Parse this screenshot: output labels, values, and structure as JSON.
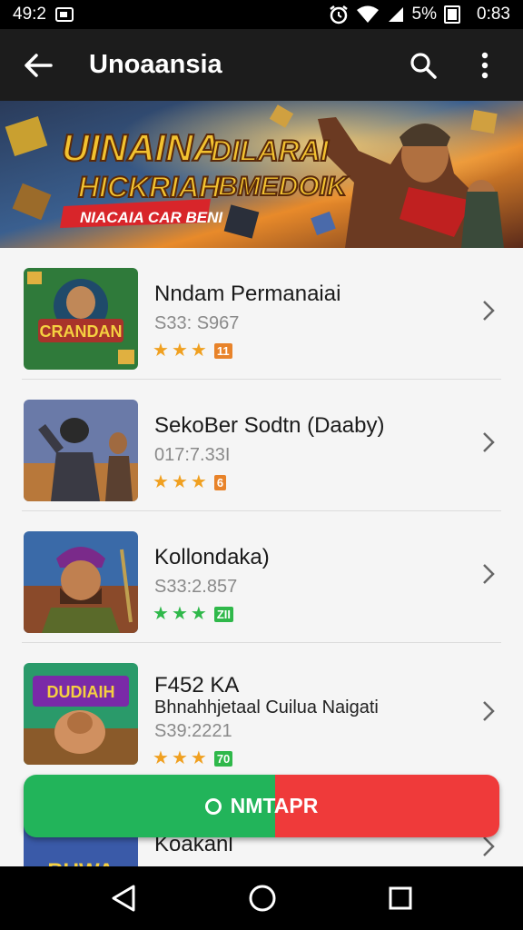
{
  "status_bar": {
    "time": "49:2",
    "battery_percent": "5%",
    "clock": "0:83"
  },
  "app_bar": {
    "title": "Unoaansia",
    "back_icon": "arrow-left-icon",
    "search_icon": "search-icon",
    "menu_icon": "more-vert-icon"
  },
  "banner": {
    "line1": "UINAINA",
    "line2": "HICKRIAH",
    "ribbon": "NIACAIA CAR BENI",
    "line3": "DILARAI",
    "line4": "BMEDOIK"
  },
  "games": [
    {
      "title": "Nndam Permanaiai",
      "subtitle": "",
      "meta": "S33: S967",
      "rating": 3,
      "badge": "11",
      "accent": "#f0a020",
      "badge_color": "#e8832a",
      "thumb_text": "CRANDAN"
    },
    {
      "title": "SekoBer Sodtn (Daaby)",
      "subtitle": "",
      "meta": "017:7.33I",
      "rating": 3,
      "badge": "6",
      "accent": "#f0a020",
      "badge_color": "#e8832a",
      "thumb_text": ""
    },
    {
      "title": "Kollondaka)",
      "subtitle": "",
      "meta": "S33:2.857",
      "rating": 3,
      "badge": "ZII",
      "accent": "#2fb84a",
      "badge_color": "#2fb84a",
      "thumb_text": ""
    },
    {
      "title": "F452 KA",
      "subtitle": "Bhnahhjetaal Cuilua Naigati",
      "meta": "S39:2221",
      "rating": 3,
      "badge": "70",
      "accent": "#f0a020",
      "badge_color": "#2fb84a",
      "thumb_text": "DUDIAIH"
    },
    {
      "title": "Koakanl",
      "subtitle": "",
      "meta": "",
      "rating": 0,
      "badge": "",
      "accent": "#f0a020",
      "badge_color": "#2fb84a",
      "thumb_text": "BUWA"
    }
  ],
  "fab": {
    "label": "NMTAPR",
    "left_color": "#22b45a",
    "right_color": "#ef3a3a"
  },
  "nav": {
    "back": "triangle-back-icon",
    "home": "circle-home-icon",
    "recents": "square-recents-icon"
  }
}
